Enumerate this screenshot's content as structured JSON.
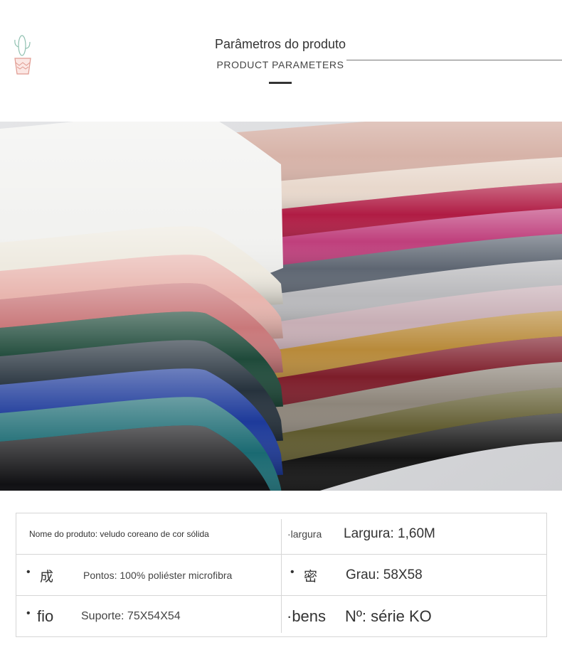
{
  "header": {
    "title": "Parâmetros do produto",
    "subtitle": "PRODUCT PARAMETERS",
    "logo_icon": "potted-cactus-icon"
  },
  "photo": {
    "stack_left": [
      "#f2f2f0",
      "#eeeae0",
      "#e8b5ae",
      "#c9787a",
      "#1f4a3a",
      "#26323d",
      "#1d3a9a",
      "#1a6a72",
      "#111114"
    ],
    "stack_right": [
      "#d7b3a8",
      "#e8d8cc",
      "#b01c44",
      "#bf3f7c",
      "#5e6672",
      "#b9b9bc",
      "#c7aeb5",
      "#b88a3a",
      "#7d1d2a",
      "#8d857a",
      "#5f5a2e",
      "#141414"
    ],
    "background": "#dadbdd"
  },
  "params": {
    "row1": {
      "left": "Nome do produto: veludo coreano de cor sólida",
      "right_label": "·largura",
      "right_value": "Largura: 1,60M"
    },
    "row2": {
      "left_bullet": "•",
      "left_label": "成",
      "left_value": "Pontos: 100% poliéster microfibra",
      "right_bullet": "•",
      "right_label": "密",
      "right_value": "Grau: 58X58"
    },
    "row3": {
      "left_bullet": "•",
      "left_label": "fio",
      "left_value": "Suporte: 75X54X54",
      "right_label": "·bens",
      "right_value": "Nº: série KO"
    }
  }
}
